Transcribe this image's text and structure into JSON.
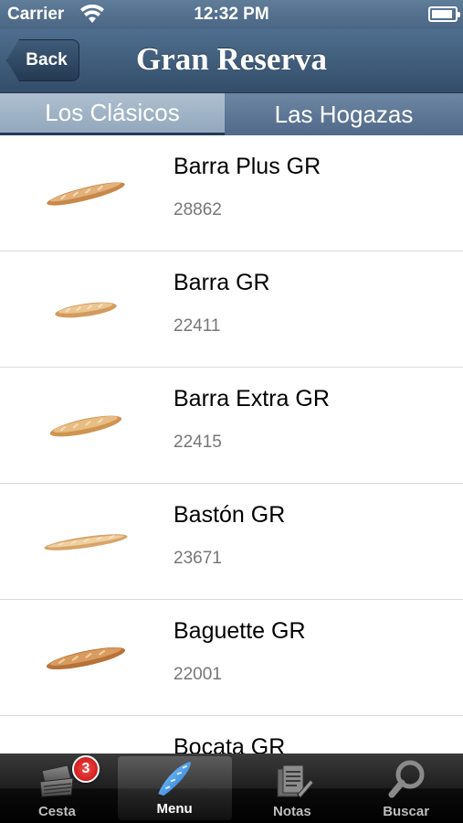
{
  "status_bar": {
    "carrier": "Carrier",
    "time": "12:32 PM",
    "wifi_icon": "wifi-icon",
    "battery_icon": "battery-icon",
    "battery_level": 0.9
  },
  "nav": {
    "back_label": "Back",
    "title": "Gran Reserva"
  },
  "tabs": [
    {
      "label": "Los Clásicos",
      "selected": true
    },
    {
      "label": "Las Hogazas",
      "selected": false
    }
  ],
  "products": [
    {
      "name": "Barra Plus GR",
      "code": "28862",
      "icon": "bread-thumbnail"
    },
    {
      "name": "Barra GR",
      "code": "22411",
      "icon": "bread-thumbnail"
    },
    {
      "name": "Barra Extra GR",
      "code": "22415",
      "icon": "bread-thumbnail"
    },
    {
      "name": "Bastón GR",
      "code": "23671",
      "icon": "bread-thumbnail"
    },
    {
      "name": "Baguette GR",
      "code": "22001",
      "icon": "bread-thumbnail"
    },
    {
      "name": "Bocata GR",
      "code": "",
      "icon": "bread-thumbnail"
    }
  ],
  "tab_bar": {
    "items": [
      {
        "label": "Cesta",
        "icon": "basket-icon",
        "badge": "3",
        "active": false
      },
      {
        "label": "Menu",
        "icon": "baguette-icon",
        "active": true
      },
      {
        "label": "Notas",
        "icon": "notes-icon",
        "active": false
      },
      {
        "label": "Buscar",
        "icon": "magnifier-icon",
        "active": false
      }
    ]
  },
  "colors": {
    "nav_blue": "#334d69",
    "tab_active": "#93a8bd",
    "badge_red": "#d61414"
  }
}
